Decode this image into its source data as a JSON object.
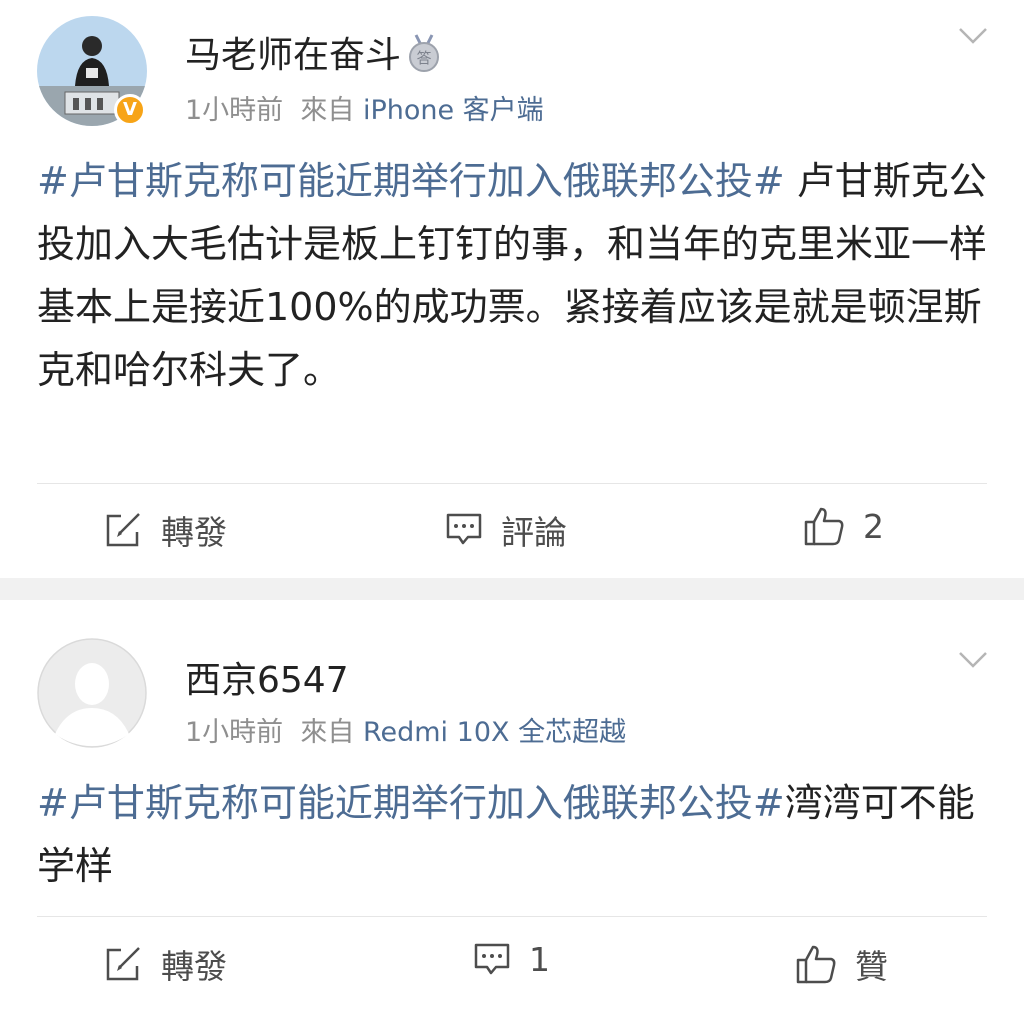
{
  "posts": [
    {
      "user": {
        "name": "马老师在奋斗",
        "verified": "V",
        "medal_glyph": "答"
      },
      "meta": {
        "time": "1小時前",
        "from": "來自",
        "source": "iPhone 客户端"
      },
      "content": {
        "hashtag": "#卢甘斯克称可能近期举行加入俄联邦公投#",
        "text": " 卢甘斯克公投加入大毛估计是板上钉钉的事，和当年的克里米亚一样基本上是接近100%的成功票。紧接着应该是就是顿涅斯克和哈尔科夫了。"
      },
      "actions": {
        "repost": "轉發",
        "comment": "評論",
        "like": "2"
      }
    },
    {
      "user": {
        "name": "西京6547"
      },
      "meta": {
        "time": "1小時前",
        "from": "來自",
        "source": "Redmi 10X 全芯超越"
      },
      "content": {
        "hashtag": "#卢甘斯克称可能近期举行加入俄联邦公投#",
        "text": "湾湾可不能学样"
      },
      "actions": {
        "repost": "轉發",
        "comment": "1",
        "like": "贊"
      }
    }
  ],
  "icons": {
    "repost": "edit-icon",
    "comment": "comment-icon",
    "like": "thumbs-up-icon",
    "more": "chevron-down-icon",
    "medal": "medal-icon"
  },
  "colors": {
    "link": "#4d6c93",
    "text": "#222222",
    "meta": "#8f8f8f",
    "badge": "#f7a417"
  }
}
